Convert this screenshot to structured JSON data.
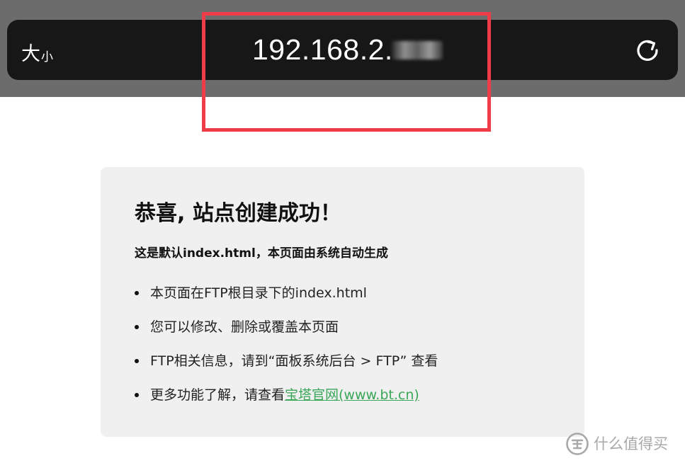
{
  "address_bar": {
    "text_size_big": "大",
    "text_size_small": "小",
    "url": "192.168.2."
  },
  "page": {
    "title": "恭喜, 站点创建成功！",
    "subtitle": "这是默认index.html，本页面由系统自动生成",
    "items": [
      {
        "text": "本页面在FTP根目录下的index.html"
      },
      {
        "text": "您可以修改、删除或覆盖本页面"
      },
      {
        "text": "FTP相关信息，请到“面板系统后台 > FTP” 查看"
      },
      {
        "text": "更多功能了解，请查看",
        "link_text": "宝塔官网(www.bt.cn)"
      }
    ]
  },
  "watermark": {
    "label": "什么值得买"
  },
  "colors": {
    "highlight": "#ee3d47",
    "link": "#3aa657",
    "card_background": "#f0f0f0",
    "address_bar": "#171717"
  },
  "icons": {
    "reload": "reload-icon",
    "watermark": "smzdm-logo-icon",
    "bullet": "bullet-icon"
  }
}
